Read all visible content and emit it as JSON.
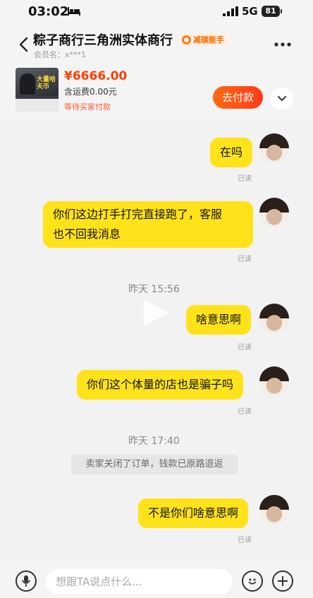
{
  "status_bar": {
    "time": "03:02",
    "network": "5G",
    "battery": "81"
  },
  "header": {
    "shop_name": "粽子商行三角洲实体商行",
    "badge": "减碳能手",
    "member": "会员名：x***1"
  },
  "order": {
    "price": "¥6666.00",
    "shipping": "含运费0.00元",
    "status": "等待买家付款",
    "pay_button": "去付款",
    "thumbnail_text": "大量哈夫币"
  },
  "messages": [
    {
      "text": "在吗",
      "read": "已读"
    },
    {
      "text_line1": "你们这边打手打完直接跑了，客服",
      "text_line2": "也不回我消息",
      "read": "已读"
    },
    {
      "text": "啥意思啊",
      "read": "已读"
    },
    {
      "text": "你们这个体量的店也是骗子吗",
      "read": "已读"
    },
    {
      "text": "不是你们啥意思啊",
      "read": "已读"
    }
  ],
  "timestamps": {
    "t1": "昨天 15:56",
    "t2": "昨天 17:40"
  },
  "system_message": "卖家关闭了订单，钱款已原路退返",
  "input": {
    "placeholder": "想跟TA说点什么..."
  },
  "colors": {
    "bubble": "#ffe31a",
    "accent": "#ff4a14",
    "price": "#ff3d00"
  },
  "icons": [
    "bed-icon",
    "signal-icon",
    "back-icon",
    "more-icon",
    "chevron-down-icon",
    "play-icon",
    "microphone-icon",
    "emoji-icon",
    "plus-icon"
  ]
}
